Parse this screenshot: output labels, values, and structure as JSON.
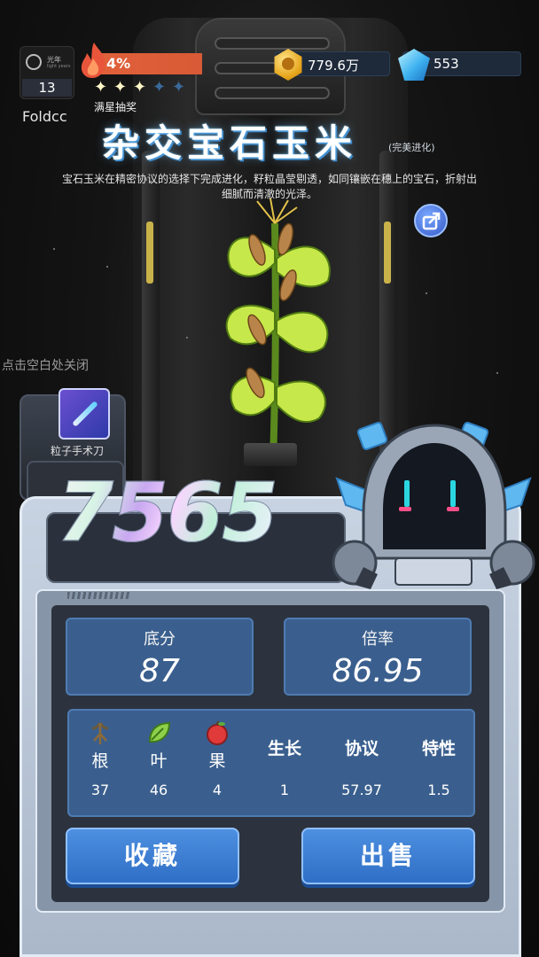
{
  "hud": {
    "lightyear_label": "光年",
    "lightyear_sub": "light years",
    "lightyear_value": "13",
    "username": "Foldcc",
    "progress_percent": "4%",
    "progress_fraction": 0.04,
    "stars_filled": 3,
    "stars_total": 5,
    "star_prize_label": "满星抽奖",
    "coins": "779.6万",
    "gems": "553"
  },
  "item": {
    "title": "杂交宝石玉米",
    "tag": "(完美进化)",
    "description": "宝石玉米在精密协议的选择下完成进化，籽粒晶莹剔透，如同镶嵌在穗上的宝石，折射出细腻而清澈的光泽。"
  },
  "side": {
    "tap_close": "点击空白处关闭",
    "tool_label": "粒子手术刀"
  },
  "result": {
    "score": "7565",
    "base_label": "底分",
    "base_value": "87",
    "rate_label": "倍率",
    "rate_value": "86.95"
  },
  "attributes": [
    {
      "name": "根",
      "value": "37",
      "icon": "root-icon"
    },
    {
      "name": "叶",
      "value": "46",
      "icon": "leaf-icon"
    },
    {
      "name": "果",
      "value": "4",
      "icon": "fruit-icon"
    },
    {
      "name": "生长",
      "value": "1"
    },
    {
      "name": "协议",
      "value": "57.97"
    },
    {
      "name": "特性",
      "value": "1.5"
    }
  ],
  "actions": {
    "collect": "收藏",
    "sell": "出售"
  },
  "colors": {
    "panel_blue": "#3a5f8e",
    "button_blue": "#2f6fc6",
    "progress_red": "#e0603a"
  }
}
